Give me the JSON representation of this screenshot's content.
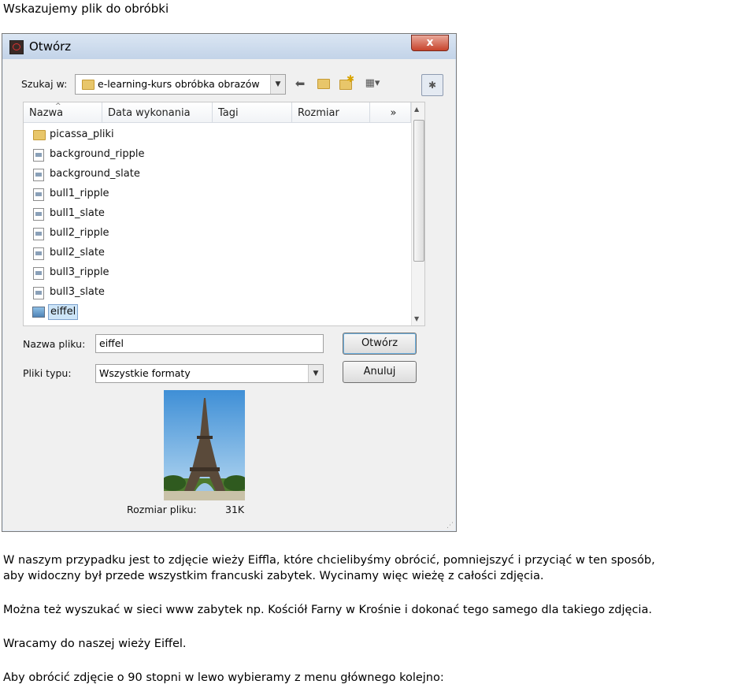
{
  "page": {
    "heading": "Wskazujemy plik do obróbki",
    "paragraph1_line1": "W naszym przypadku jest to zdjęcie wieży Eiffla, które chcielibyśmy obrócić, pomniejszyć i przyciąć w ten sposób,",
    "paragraph1_line2": "aby widoczny był przede wszystkim francuski zabytek. Wycinamy więc wieżę z całości zdjęcia.",
    "paragraph2": "Można też wyszukać w sieci www zabytek np. Kościół Farny w Krośnie i dokonać tego samego dla takiego zdjęcia.",
    "paragraph3": "Wracamy do naszej wieży Eiffel.",
    "paragraph4": "Aby obrócić zdjęcie o 90 stopni w lewo wybieramy z menu głównego kolejno:"
  },
  "dialog": {
    "title": "Otwórz",
    "close_symbol": "x",
    "look_in_label": "Szukaj w:",
    "look_in_value": "e-learning-kurs obróbka obrazów",
    "toolbar_icons": [
      "back-icon",
      "up-folder-icon",
      "new-folder-icon",
      "view-menu-icon"
    ],
    "columns": [
      "Nazwa",
      "Data wykonania",
      "Tagi",
      "Rozmiar",
      "»"
    ],
    "files": [
      {
        "name": "picassa_pliki",
        "type": "folder"
      },
      {
        "name": "background_ripple",
        "type": "file"
      },
      {
        "name": "background_slate",
        "type": "file"
      },
      {
        "name": "bull1_ripple",
        "type": "file"
      },
      {
        "name": "bull1_slate",
        "type": "file"
      },
      {
        "name": "bull2_ripple",
        "type": "file"
      },
      {
        "name": "bull2_slate",
        "type": "file"
      },
      {
        "name": "bull3_ripple",
        "type": "file"
      },
      {
        "name": "bull3_slate",
        "type": "file"
      },
      {
        "name": "eiffel",
        "type": "image",
        "selected": true
      }
    ],
    "filename_label": "Nazwa pliku:",
    "filename_value": "eiffel",
    "filetype_label": "Pliki typu:",
    "filetype_value": "Wszystkie formaty",
    "open_button": "Otwórz",
    "cancel_button": "Anuluj",
    "file_size_label": "Rozmiar pliku:",
    "file_size_value": "31K"
  },
  "colors": {
    "titlebar": "#c9d8ea",
    "selection": "#cde5f8",
    "close_button": "#c7432b",
    "dialog_bg": "#f0f0f0"
  }
}
